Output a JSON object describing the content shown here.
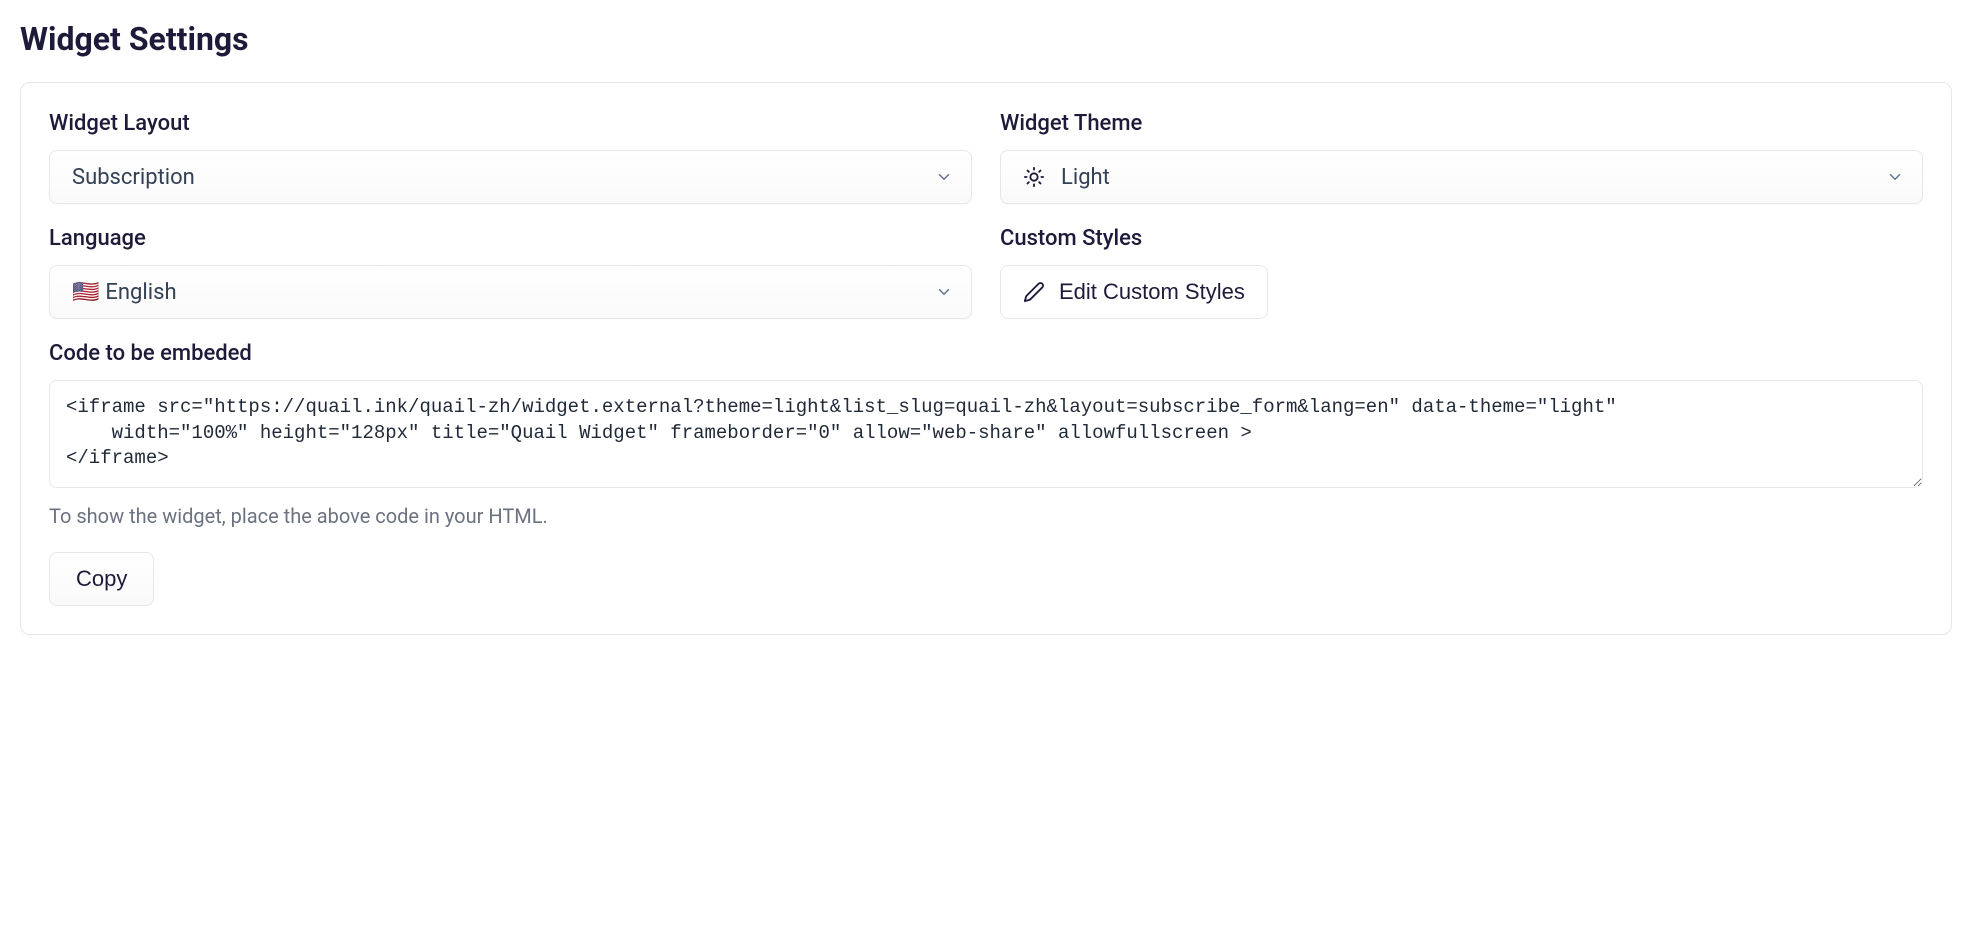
{
  "page": {
    "title": "Widget Settings"
  },
  "layout": {
    "label": "Widget Layout",
    "value": "Subscription"
  },
  "theme": {
    "label": "Widget Theme",
    "value": "Light",
    "iconName": "sun-icon"
  },
  "language": {
    "label": "Language",
    "flag": "🇺🇸",
    "value": "English"
  },
  "customStyles": {
    "label": "Custom Styles",
    "buttonLabel": "Edit Custom Styles"
  },
  "embed": {
    "label": "Code to be embeded",
    "code": "<iframe src=\"https://quail.ink/quail-zh/widget.external?theme=light&list_slug=quail-zh&layout=subscribe_form&lang=en\" data-theme=\"light\"\n    width=\"100%\" height=\"128px\" title=\"Quail Widget\" frameborder=\"0\" allow=\"web-share\" allowfullscreen >\n</iframe>",
    "hint": "To show the widget, place the above code in your HTML."
  },
  "actions": {
    "copy": "Copy"
  }
}
